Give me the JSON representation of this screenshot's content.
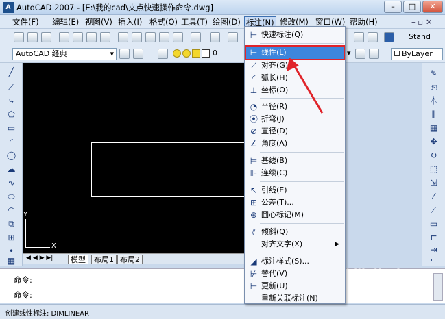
{
  "title": "AutoCAD 2007 - [E:\\我的cad\\夹点快速操作命令.dwg]",
  "app_icon": "A",
  "menus": [
    {
      "label": "文件(F)"
    },
    {
      "label": "编辑(E)"
    },
    {
      "label": "视图(V)"
    },
    {
      "label": "插入(I)"
    },
    {
      "label": "格式(O)"
    },
    {
      "label": "工具(T)"
    },
    {
      "label": "绘图(D)"
    },
    {
      "label": "标注(N)"
    },
    {
      "label": "修改(M)"
    },
    {
      "label": "窗口(W)"
    },
    {
      "label": "帮助(H)"
    }
  ],
  "toolbar": {
    "workspace": "AutoCAD 经典",
    "layer_value": "0",
    "style_label": "Stand",
    "bylayer": "ByLayer"
  },
  "dimension_menu": {
    "items": [
      {
        "label": "快速标注(Q)",
        "icon": "quick-dim-icon"
      },
      {
        "label": "线性(L)",
        "icon": "linear-dim-icon",
        "highlighted": true
      },
      {
        "label": "对齐(G)",
        "icon": "aligned-dim-icon"
      },
      {
        "label": "弧长(H)",
        "icon": "arc-length-icon"
      },
      {
        "label": "坐标(O)",
        "icon": "ordinate-icon"
      },
      {
        "label": "半径(R)",
        "icon": "radius-icon"
      },
      {
        "label": "折弯(J)",
        "icon": "jogged-icon"
      },
      {
        "label": "直径(D)",
        "icon": "diameter-icon"
      },
      {
        "label": "角度(A)",
        "icon": "angular-icon"
      },
      {
        "label": "基线(B)",
        "icon": "baseline-icon"
      },
      {
        "label": "连续(C)",
        "icon": "continue-icon"
      },
      {
        "label": "引线(E)",
        "icon": "leader-icon"
      },
      {
        "label": "公差(T)...",
        "icon": "tolerance-icon"
      },
      {
        "label": "圆心标记(M)",
        "icon": "center-mark-icon"
      },
      {
        "label": "倾斜(Q)",
        "icon": "oblique-icon"
      },
      {
        "label": "对齐文字(X)",
        "icon": "",
        "submenu": true
      },
      {
        "label": "标注样式(S)...",
        "icon": "dim-style-icon"
      },
      {
        "label": "替代(V)",
        "icon": "override-icon"
      },
      {
        "label": "更新(U)",
        "icon": "update-icon"
      },
      {
        "label": "重新关联标注(N)",
        "icon": ""
      }
    ]
  },
  "tabs": [
    "模型",
    "布局1",
    "布局2"
  ],
  "ucs": {
    "x_label": "X",
    "y_label": "Y"
  },
  "command": {
    "line1": "命令:",
    "line2": "命令:"
  },
  "status_text": "创建线性标注:  DIMLINEAR",
  "watermark": "搜狗指南",
  "watermark_url": "zhinan.sogou.com",
  "colors": {
    "highlight": "#3d86dc",
    "annotation": "#e0242a",
    "drawing_bg": "#000000"
  }
}
